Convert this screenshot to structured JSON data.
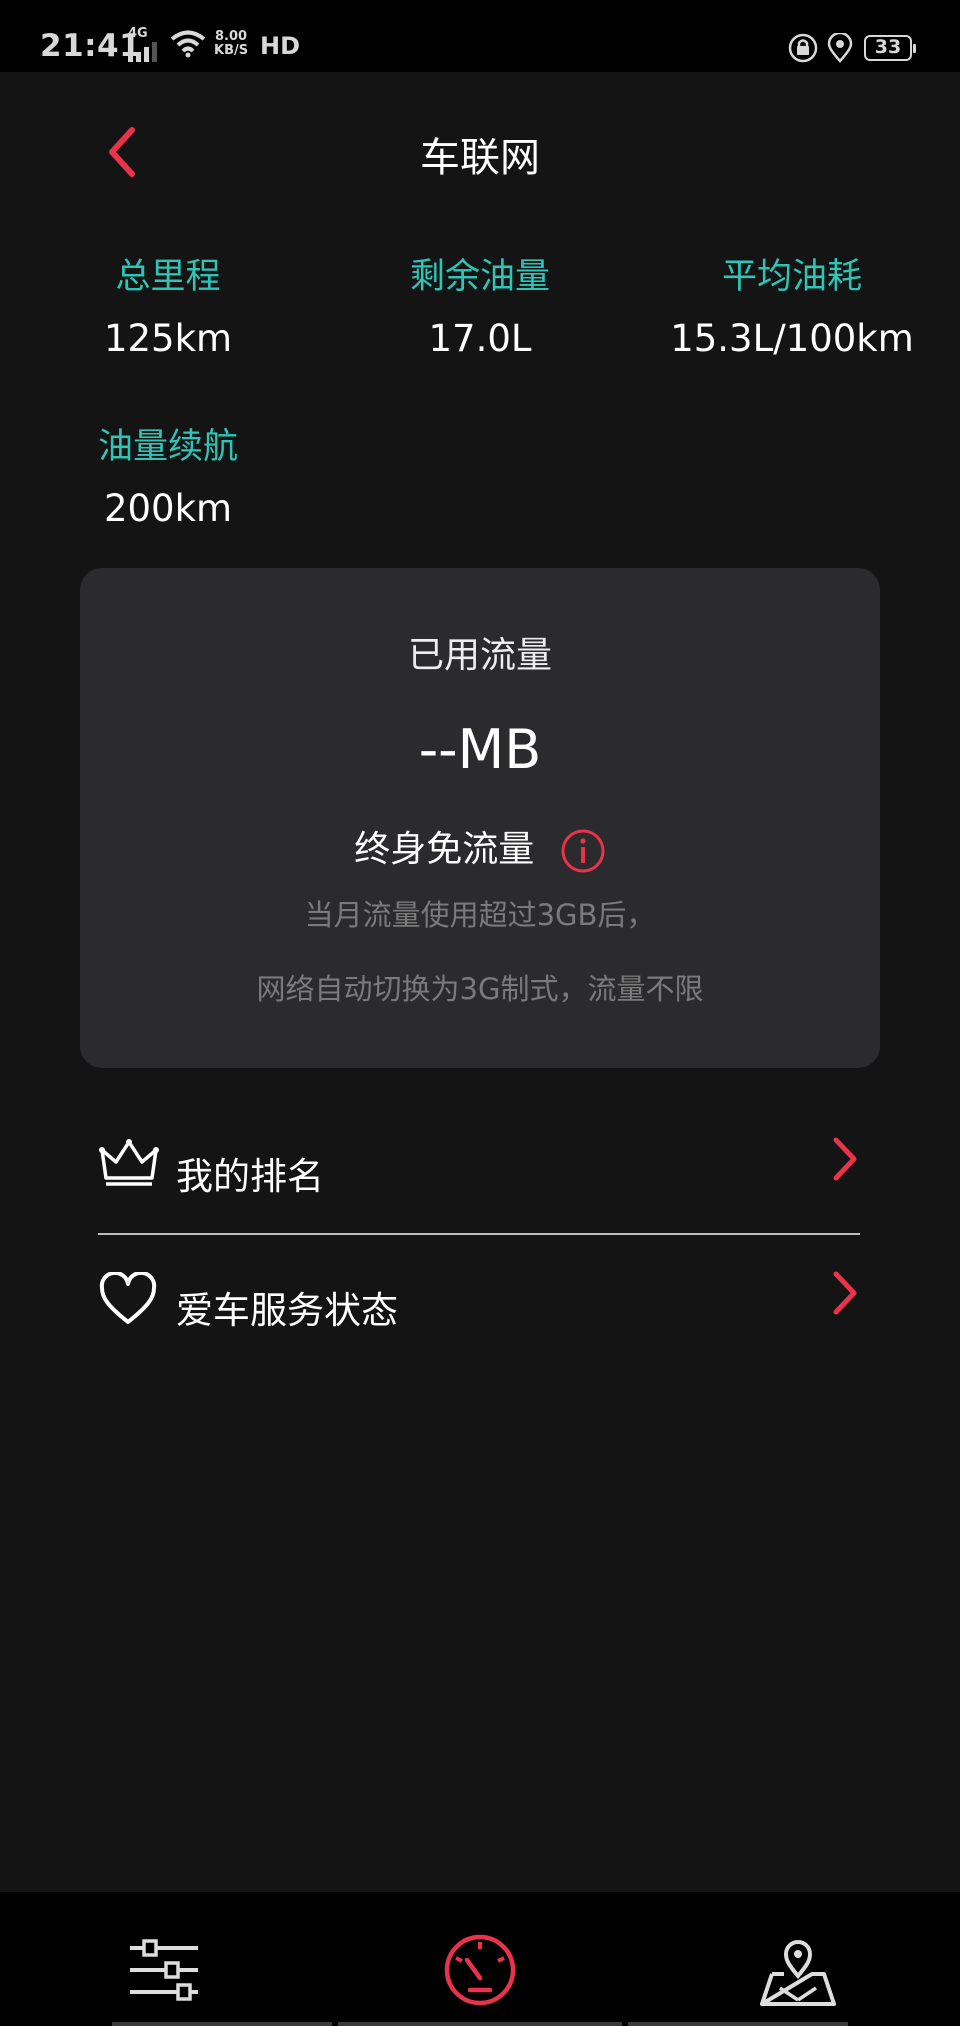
{
  "status_bar": {
    "time": "21:41",
    "network": "4G",
    "speed_top": "8.00",
    "speed_bottom": "KB/S",
    "hd": "HD",
    "battery": "33"
  },
  "header": {
    "title": "车联网",
    "back_icon": "chevron-left-icon"
  },
  "stats": [
    {
      "label": "总里程",
      "value": "125km"
    },
    {
      "label": "剩余油量",
      "value": "17.0L"
    },
    {
      "label": "平均油耗",
      "value": "15.3L/100km"
    },
    {
      "label": "油量续航",
      "value": "200km"
    }
  ],
  "data_card": {
    "title": "已用流量",
    "amount": "--MB",
    "free_label": "终身免流量",
    "note_line1": "当月流量使用超过3GB后，",
    "note_line2": "网络自动切换为3G制式，流量不限"
  },
  "menu": [
    {
      "label": "我的排名",
      "icon": "crown-icon"
    },
    {
      "label": "爱车服务状态",
      "icon": "heart-icon"
    }
  ],
  "bottom_tabs": [
    {
      "icon": "sliders-icon"
    },
    {
      "icon": "speedometer-icon",
      "active": true
    },
    {
      "icon": "map-pin-icon"
    }
  ],
  "colors": {
    "accent": "#e8334a",
    "teal": "#2ec4b6",
    "background": "#141414",
    "card": "#2b2b2d"
  }
}
